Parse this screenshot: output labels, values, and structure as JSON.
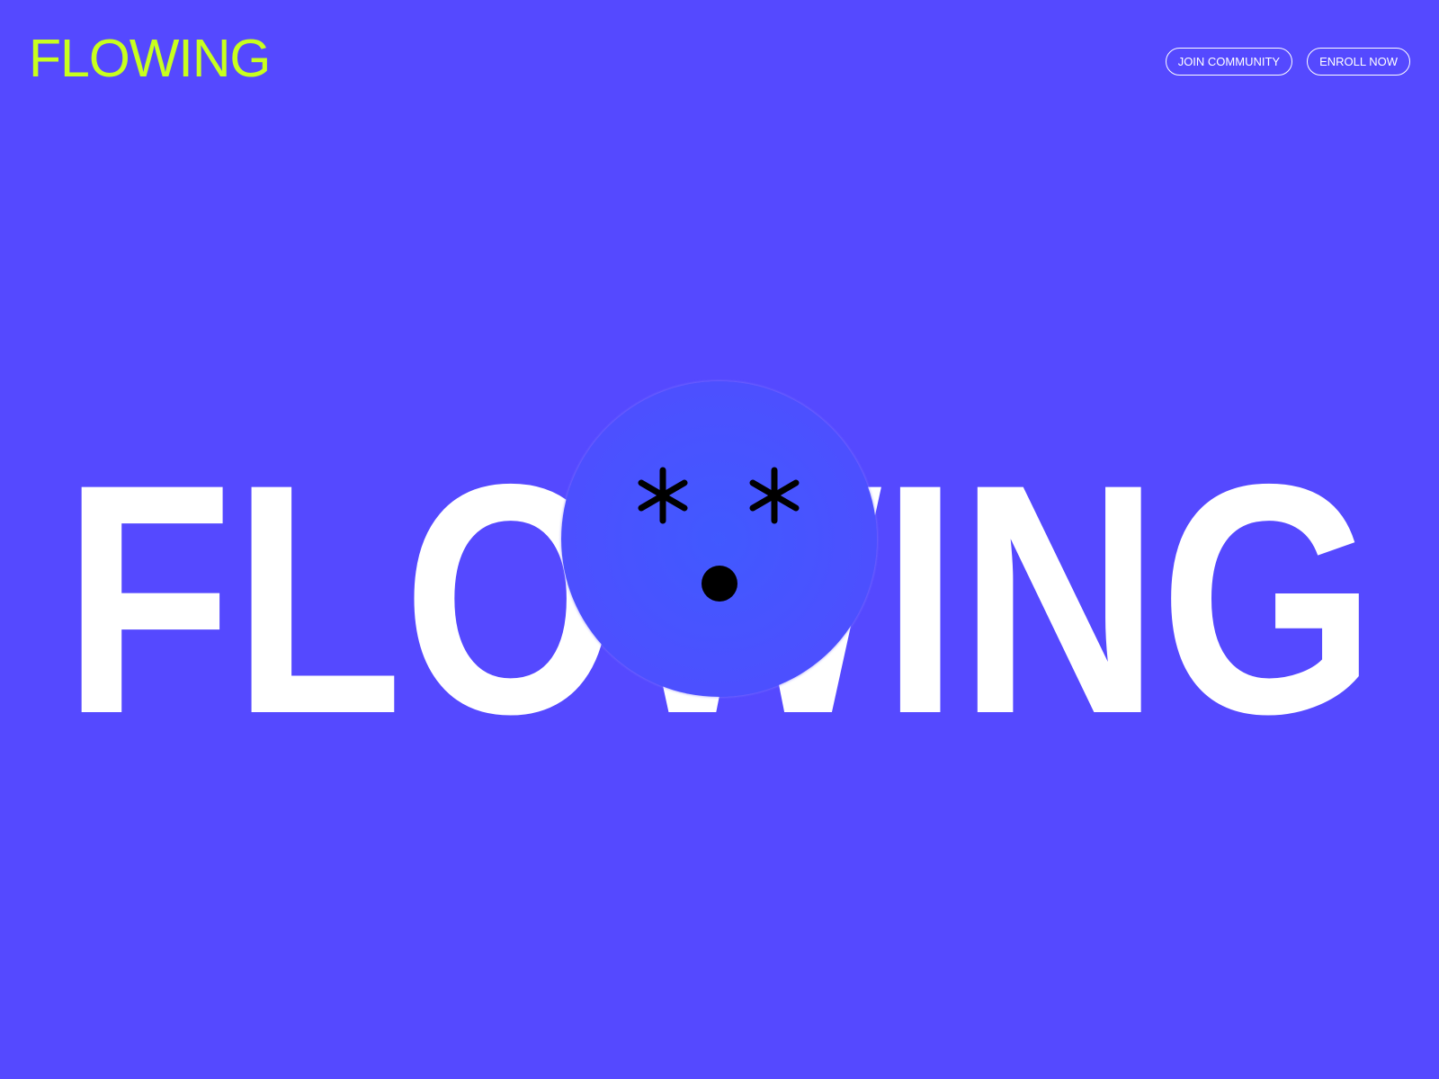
{
  "header": {
    "logo": "FLOWING",
    "nav": [
      {
        "label": "JOIN COMMUNITY"
      },
      {
        "label": "ENROLL NOW"
      }
    ]
  },
  "hero": {
    "word": "FLOWING"
  },
  "colors": {
    "background": "#5549FF",
    "accent": "#C8FF1E",
    "hero_text": "#FFFFFF",
    "blob": "#4159FF",
    "face_marks": "#000000"
  },
  "icons": {
    "left_eye": "asterisk-icon",
    "right_eye": "asterisk-icon",
    "mouth": "dot-icon"
  }
}
